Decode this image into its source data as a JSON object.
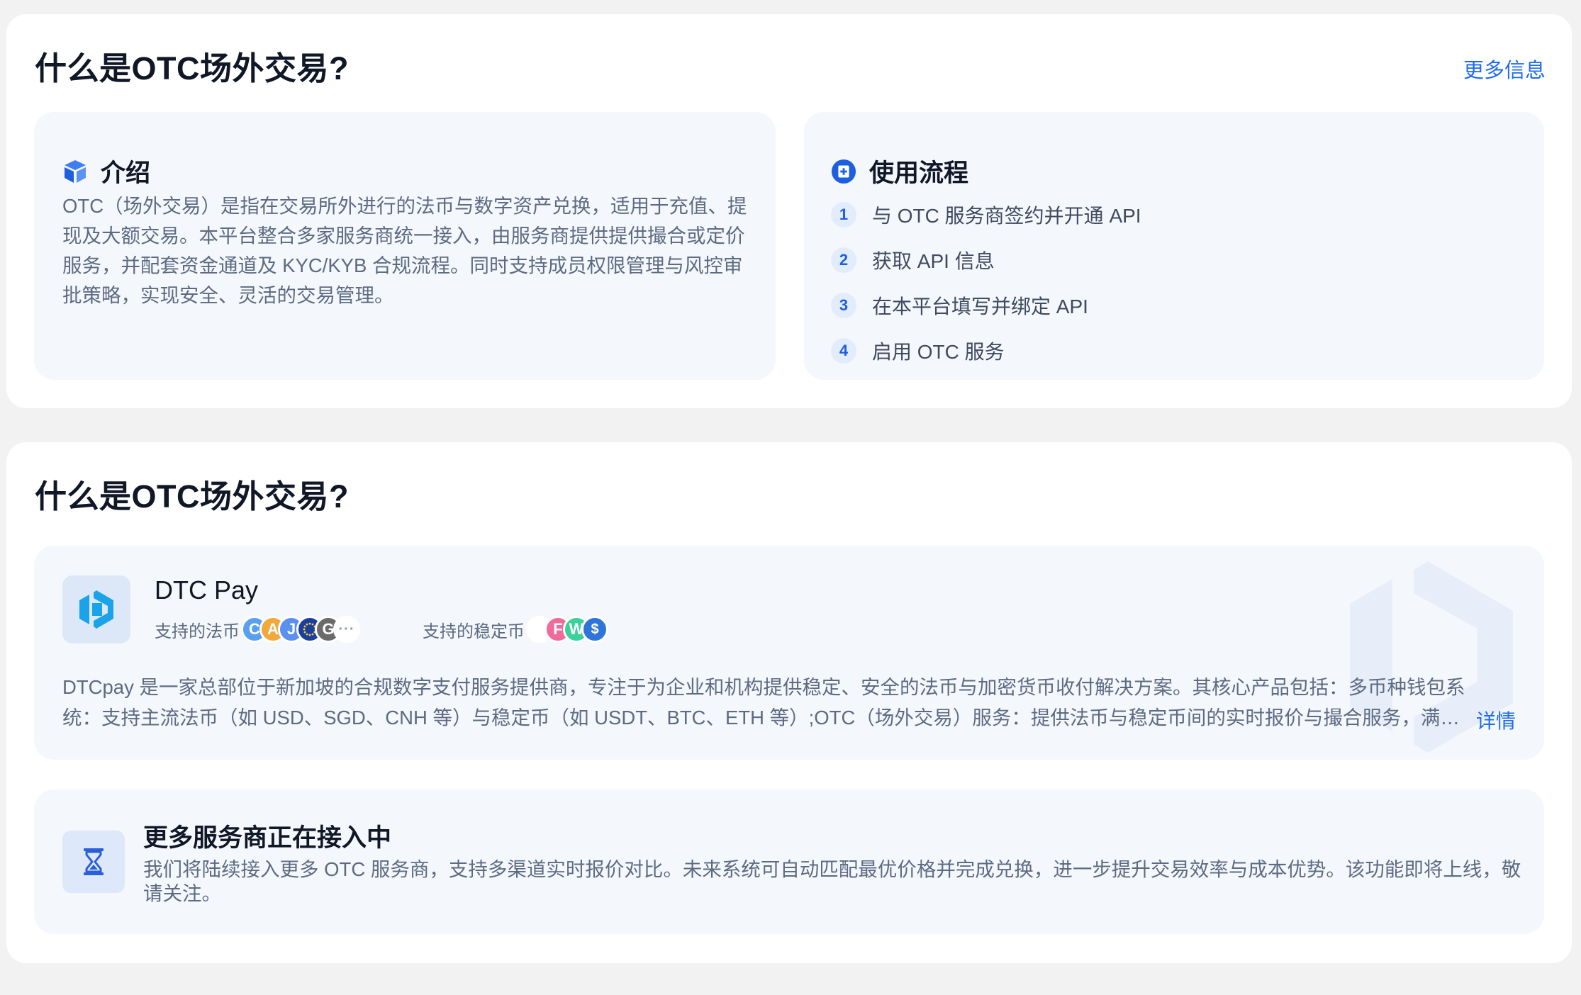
{
  "section1": {
    "title": "什么是OTC场外交易?",
    "more_link": "更多信息",
    "intro": {
      "icon": "cube-icon",
      "title": "介绍",
      "text": "OTC（场外交易）是指在交易所外进行的法币与数字资产兑换，适用于充值、提现及大额交易。本平台整合多家服务商统一接入，由服务商提供提供撮合或定价服务，并配套资金通道及 KYC/KYB 合规流程。同时支持成员权限管理与风控审批策略，实现安全、灵活的交易管理。"
    },
    "flow": {
      "icon": "flow-icon",
      "title": "使用流程",
      "steps": [
        {
          "num": "1",
          "text": "与 OTC 服务商签约并开通 API"
        },
        {
          "num": "2",
          "text": "获取 API 信息"
        },
        {
          "num": "3",
          "text": "在本平台填写并绑定 API"
        },
        {
          "num": "4",
          "text": "启用 OTC 服务"
        }
      ]
    }
  },
  "section2": {
    "title": "什么是OTC场外交易?",
    "provider": {
      "name": "DTC Pay",
      "fiat_label": "支持的法币",
      "fiat_coins": [
        {
          "letter": "C",
          "color": "#5aa0f0"
        },
        {
          "letter": "A",
          "color": "#f0a93a"
        },
        {
          "letter": "J",
          "color": "#5b8ff0"
        },
        {
          "letter": "",
          "color": "#1d3f9c"
        },
        {
          "letter": "G",
          "color": "#6b6b6b"
        }
      ],
      "fiat_more": "···",
      "stable_label": "支持的稳定币",
      "stable_coins": [
        {
          "letter": "",
          "color": "#ffffff"
        },
        {
          "letter": "F",
          "color": "#ef6b9a"
        },
        {
          "letter": "W",
          "color": "#3ad19a"
        },
        {
          "letter": "$",
          "color": "#2f74d8"
        }
      ],
      "description": "DTCpay 是一家总部位于新加坡的合规数字支付服务提供商，专注于为企业和机构提供稳定、安全的法币与加密货币收付解决方案。其核心产品包括：多币种钱包系统：支持主流法币（如 USD、SGD、CNH 等）与稳定币（如 USDT、BTC、ETH 等）;OTC（场外交易）服务：提供法币与稳定币间的实时报价与撮合服务，满足大额交易需求。",
      "detail_link": "详情"
    },
    "coming": {
      "icon": "hourglass-icon",
      "title": "更多服务商正在接入中",
      "text": "我们将陆续接入更多 OTC 服务商，支持多渠道实时报价对比。未来系统可自动匹配最优价格并完成兑换，进一步提升交易效率与成本优势。该功能即将上线，敬请关注。"
    }
  },
  "colors": {
    "accent": "#1e6bf0",
    "page_bg": "#f2f2f2",
    "card_bg": "#f4f7fc"
  }
}
